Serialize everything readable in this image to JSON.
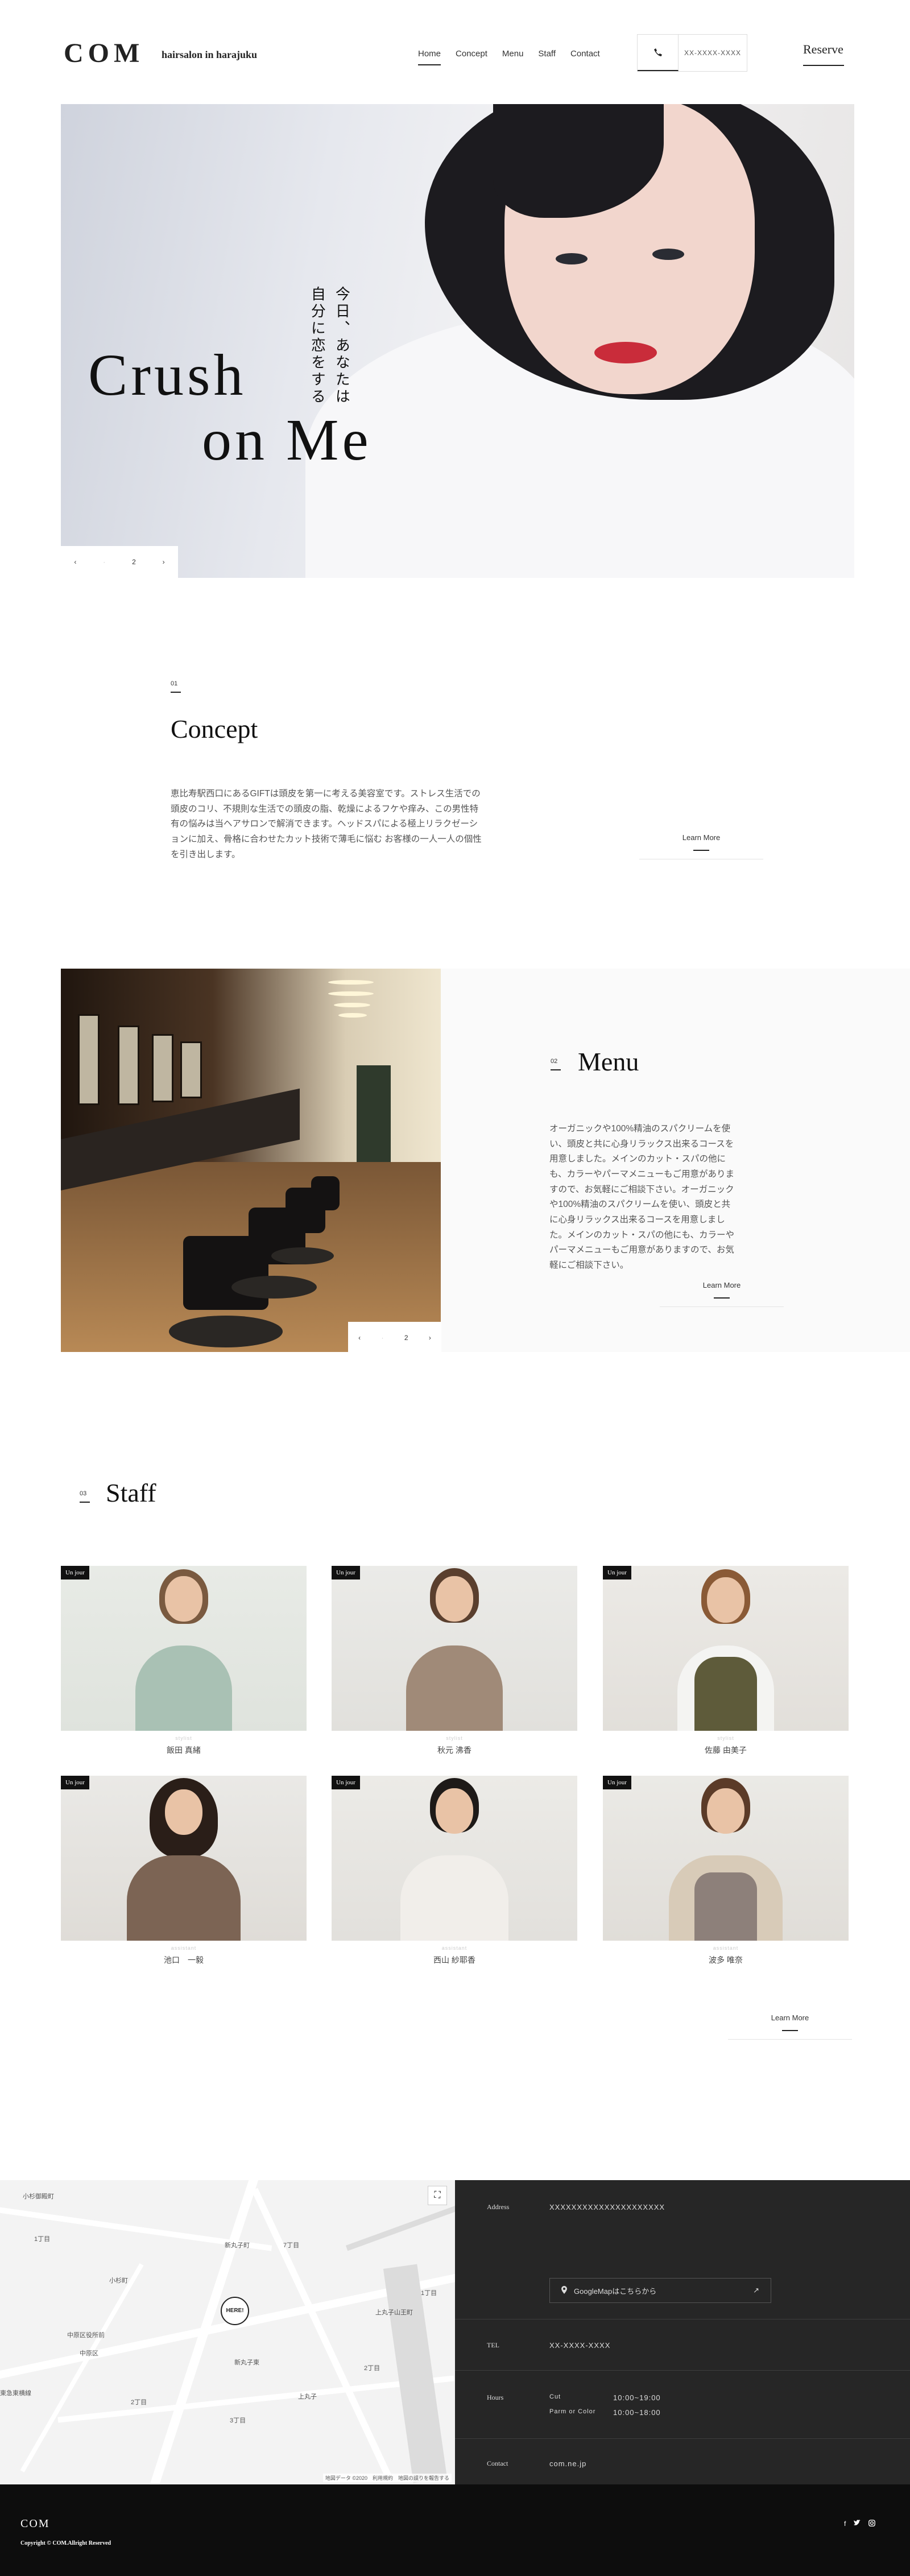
{
  "header": {
    "logo": "COM",
    "tagline": "hairsalon in harajuku",
    "nav": [
      "Home",
      "Concept",
      "Menu",
      "Staff",
      "Contact"
    ],
    "phone_icon": "phone-icon",
    "phone": "XX-XXXX-XXXX",
    "reserve": "Reserve"
  },
  "hero": {
    "title_line1": "Crush",
    "title_line2": "on Me",
    "vertical_line1": "今日、あなたは",
    "vertical_line2": "自分に恋をする",
    "pager_prev": "‹",
    "pager_index": "2",
    "pager_next": "›"
  },
  "concept": {
    "num": "01",
    "title": "Concept",
    "text": "恵比寿駅西口にあるGIFTは頭皮を第一に考える美容室です。ストレス生活での頭皮のコリ、不規則な生活での頭皮の脂、乾燥によるフケや痒み、この男性特有の悩みは当ヘアサロンで解消できます。ヘッドスパによる極上リラクゼーションに加え、骨格に合わせたカット技術で薄毛に悩む お客様の一人一人の個性を引き出します。",
    "learn_more": "Learn More"
  },
  "menu": {
    "num": "02",
    "title": "Menu",
    "text": "オーガニックや100%精油のスパクリームを使い、頭皮と共に心身リラックス出来るコースを用意しました。メインのカット・スパの他にも、カラーやパーマメニューもご用意がありますので、お気軽にご相談下さい。オーガニックや100%精油のスパクリームを使い、頭皮と共に心身リラックス出来るコースを用意しました。メインのカット・スパの他にも、カラーやパーマメニューもご用意がありますので、お気軽にご相談下さい。",
    "learn_more": "Learn More",
    "pager_index": "2"
  },
  "staff": {
    "num": "03",
    "title": "Staff",
    "badge": "Un jour",
    "role": "stylist",
    "members": [
      {
        "name": "飯田 真緒",
        "role": "stylist"
      },
      {
        "name": "秋元 沸香",
        "role": "stylist"
      },
      {
        "name": "佐藤 由美子",
        "role": "stylist"
      },
      {
        "name": "池口　一毅",
        "role": "assistant"
      },
      {
        "name": "西山 紗耶香",
        "role": "assistant"
      },
      {
        "name": "波多 唯奈",
        "role": "assistant"
      }
    ],
    "learn_more": "Learn More"
  },
  "map": {
    "labels": [
      "小杉御殿町",
      "1丁目",
      "新丸子町",
      "小杉町",
      "7丁目",
      "上丸子山王町",
      "中原区役所前",
      "中原区",
      "新丸子東",
      "1丁目",
      "上丸子",
      "2丁目",
      "東急東横線",
      "2丁目",
      "3丁目"
    ],
    "marker": "HERE!",
    "footer": "地図データ ©2020　利用規約　地図の誤りを報告する"
  },
  "info": {
    "address_label": "Address",
    "address": "XXXXXXXXXXXXXXXXXXXXX",
    "gmap_button": "GoogleMapはこちらから",
    "tel_label": "TEL",
    "tel": "XX-XXXX-XXXX",
    "hours_label": "Hours",
    "hours": [
      {
        "item": "Cut",
        "time": "10:00~19:00"
      },
      {
        "item": "Parm or Color",
        "time": "10:00~18:00"
      }
    ],
    "contact_label": "Contact",
    "contact": "com.ne.jp"
  },
  "footer": {
    "logo": "COM",
    "copyright": "Copyright © COM.Allright Reserved",
    "social": [
      "facebook-icon",
      "twitter-icon",
      "instagram-icon"
    ]
  },
  "colors": {
    "text": "#222222",
    "accent": "#111111",
    "panel": "#262626",
    "footer": "#0d0d0d"
  }
}
